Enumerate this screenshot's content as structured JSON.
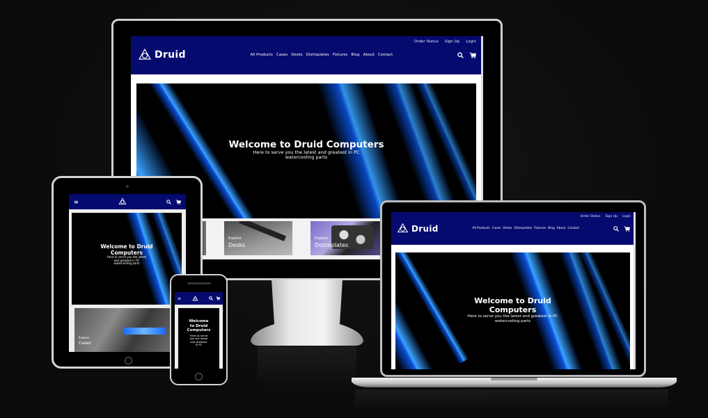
{
  "brand": {
    "name": "Druid",
    "logo": "celtic-knot-logo"
  },
  "topbar": {
    "links": [
      "Order Status",
      "Sign Up",
      "Login"
    ]
  },
  "nav": {
    "items": [
      "All Products",
      "Cases",
      "Desks",
      "Distroplates",
      "Fixtures",
      "Blog",
      "About",
      "Contact"
    ]
  },
  "hero": {
    "title": "Welcome to Druid Computers",
    "title_two_line": [
      "Welcome to Druid",
      "Computers"
    ],
    "title_phone": [
      "Welcome",
      "to Druid",
      "Computers"
    ],
    "subtitle": [
      "Here to serve you the latest and greatest in PC",
      "watercooling parts"
    ],
    "subtitle_tablet": [
      "Here to serve you the latest",
      "and greatest in PC",
      "watercooling parts"
    ],
    "subtitle_phone": [
      "Here to serve",
      "you the latest",
      "and greatest",
      "in PC"
    ]
  },
  "categories": [
    {
      "kicker": "Explore",
      "name": "Desks"
    },
    {
      "kicker": "Explore",
      "name": "Distroplates"
    },
    {
      "kicker": "Explore",
      "name": "Cases"
    }
  ],
  "icons": {
    "search": "search-icon",
    "cart": "cart-icon",
    "menu": "hamburger-menu-icon"
  },
  "colors": {
    "header": "#050a6e",
    "hero_bg": "#000000",
    "accent": "#1e73ff",
    "bezel": "#000000",
    "frame": "#cfcfcf"
  }
}
